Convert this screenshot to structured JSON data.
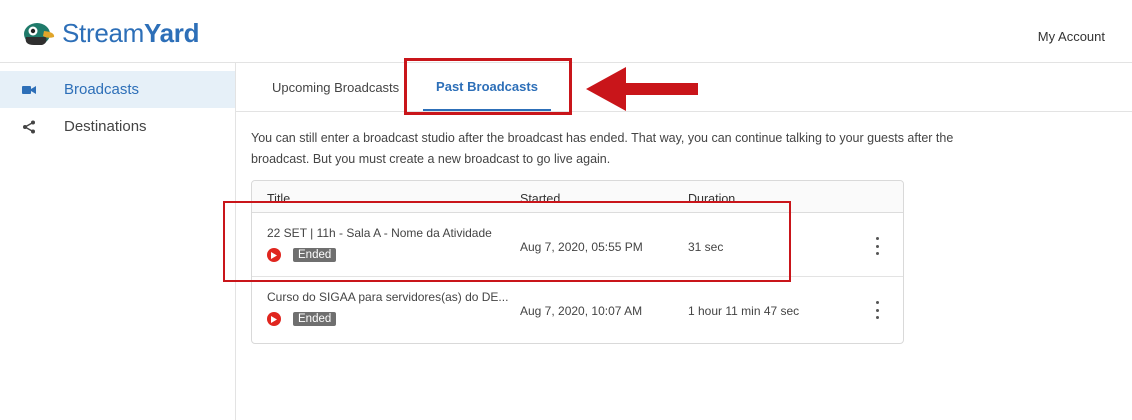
{
  "header": {
    "logo_text_a": "Stream",
    "logo_text_b": "Yard",
    "my_account": "My Account"
  },
  "sidebar": {
    "items": [
      {
        "label": "Broadcasts",
        "icon": "camera-icon",
        "active": true
      },
      {
        "label": "Destinations",
        "icon": "share-icon",
        "active": false
      }
    ]
  },
  "tabs": [
    {
      "label": "Upcoming Broadcasts",
      "active": false
    },
    {
      "label": "Past Broadcasts",
      "active": true
    }
  ],
  "note": "You can still enter a broadcast studio after the broadcast has ended. That way, you can continue talking to your guests after the broadcast. But you must create a new broadcast to go live again.",
  "table": {
    "headers": {
      "title": "Title",
      "started": "Started",
      "duration": "Duration"
    },
    "rows": [
      {
        "title": "22 SET | 11h - Sala A - Nome da Atividade",
        "status": "Ended",
        "started": "Aug 7, 2020, 05:55 PM",
        "duration": "31 sec",
        "platform_icon": "youtube-icon"
      },
      {
        "title": "Curso do SIGAA para servidores(as) do DE...",
        "status": "Ended",
        "started": "Aug 7, 2020, 10:07 AM",
        "duration": "1 hour 11 min 47 sec",
        "platform_icon": "youtube-icon"
      }
    ]
  },
  "colors": {
    "brand_blue": "#2d6fb8",
    "annotation_red": "#c9151a",
    "youtube_red": "#e0261f",
    "badge_gray": "#6f6f6f"
  }
}
